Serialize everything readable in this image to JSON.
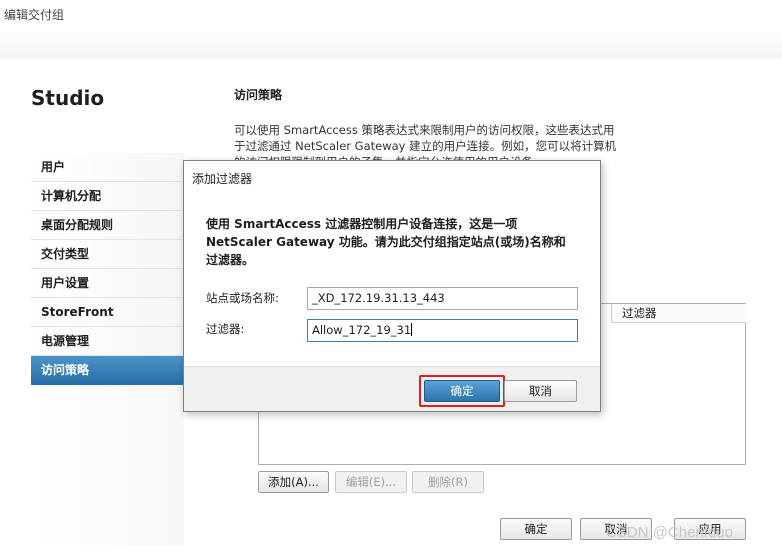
{
  "window": {
    "title": "编辑交付组"
  },
  "app": {
    "name": "Studio"
  },
  "nav": {
    "items": [
      {
        "label": "用户",
        "active": false
      },
      {
        "label": "计算机分配",
        "active": false
      },
      {
        "label": "桌面分配规则",
        "active": false
      },
      {
        "label": "交付类型",
        "active": false
      },
      {
        "label": "用户设置",
        "active": false
      },
      {
        "label": "StoreFront",
        "active": false
      },
      {
        "label": "电源管理",
        "active": false
      },
      {
        "label": "访问策略",
        "active": true
      }
    ]
  },
  "main": {
    "section_title": "访问策略",
    "description": "可以使用 SmartAccess 策略表达式来限制用户的访问权限，这些表达式用于过滤通过 NetScaler Gateway 建立的用户连接。例如，您可以将计算机的访问权限限制到用户的子集，并指定允许使用的用户设备。",
    "table": {
      "column_filter": "过滤器"
    },
    "buttons": {
      "add": "添加(A)...",
      "edit": "编辑(E)...",
      "delete": "删除(R)"
    }
  },
  "footer": {
    "ok": "确定",
    "cancel": "取消",
    "apply": "应用"
  },
  "dialog": {
    "title": "添加过滤器",
    "message": "使用 SmartAccess 过滤器控制用户设备连接，这是一项 NetScaler Gateway 功能。请为此交付组指定站点(或场)名称和过滤器。",
    "site_label": "站点或场名称:",
    "site_value": "_XD_172.19.31.13_443",
    "filter_label": "过滤器:",
    "filter_value": "Allow_172_19_31",
    "ok": "确定",
    "cancel": "取消"
  },
  "watermark": "CSDN @Chenfduo",
  "colors": {
    "accent": "#2a70a8",
    "highlight": "#e02020"
  }
}
